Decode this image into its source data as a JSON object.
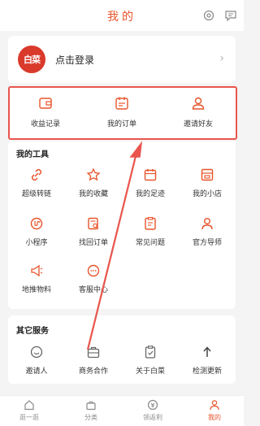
{
  "header": {
    "title": "我的"
  },
  "login": {
    "logo_text": "白菜",
    "label": "点击登录",
    "arrow": "›"
  },
  "records": [
    {
      "icon": "wallet-icon",
      "label": "收益记录"
    },
    {
      "icon": "order-icon",
      "label": "我的订单"
    },
    {
      "icon": "person-icon",
      "label": "邀请好友"
    }
  ],
  "tools": {
    "title": "我的工具",
    "items": [
      {
        "icon": "link-icon",
        "label": "超级转链"
      },
      {
        "icon": "star-icon",
        "label": "我的收藏"
      },
      {
        "icon": "calendar-icon",
        "label": "我的足迹"
      },
      {
        "icon": "shop-icon",
        "label": "我的小店"
      },
      {
        "icon": "mini-program-icon",
        "label": "小程序"
      },
      {
        "icon": "find-order-icon",
        "label": "找回订单"
      },
      {
        "icon": "faq-icon",
        "label": "常见问题"
      },
      {
        "icon": "mentor-icon",
        "label": "官方导师"
      },
      {
        "icon": "promo-material-icon",
        "label": "地推物料"
      },
      {
        "icon": "customer-service-icon",
        "label": "客服中心"
      }
    ]
  },
  "services": {
    "title": "其它服务",
    "items": [
      {
        "icon": "smile-icon",
        "label": "邀请人"
      },
      {
        "icon": "briefcase-icon",
        "label": "商务合作"
      },
      {
        "icon": "clipboard-icon",
        "label": "关于白菜"
      },
      {
        "icon": "update-icon",
        "label": "检测更新"
      }
    ]
  },
  "tabbar": [
    {
      "icon": "home-icon",
      "label": "逛一逛",
      "active": false
    },
    {
      "icon": "category-icon",
      "label": "分类",
      "active": false
    },
    {
      "icon": "rebate-icon",
      "label": "领返利",
      "active": false
    },
    {
      "icon": "profile-icon",
      "label": "我的",
      "active": true
    }
  ],
  "colors": {
    "accent": "#e8542a",
    "highlight_box": "#e8554d"
  }
}
